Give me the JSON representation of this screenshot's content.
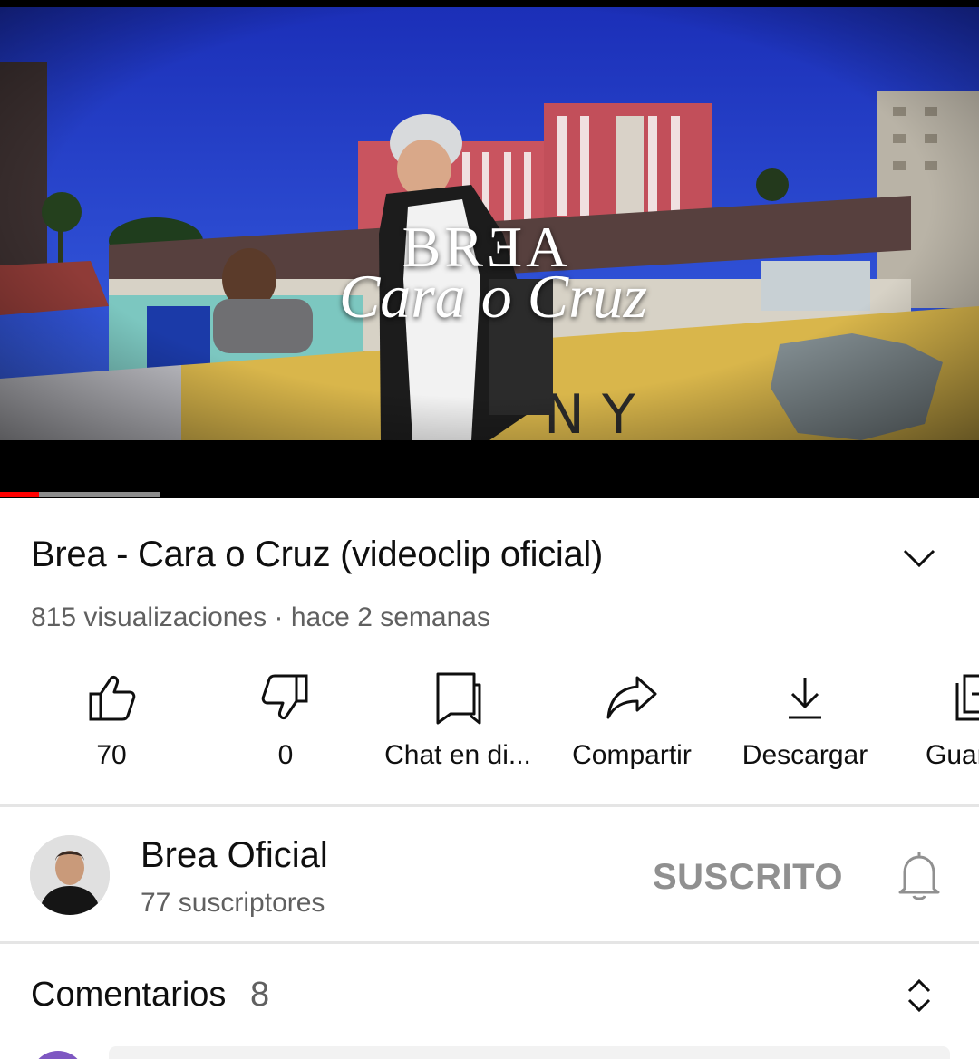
{
  "player": {
    "overlay_artist": "BRƎA",
    "overlay_song": "Cara o Cruz",
    "progress_watched": 0.04,
    "progress_buffered": 0.163,
    "progress_color": "#ff0000"
  },
  "video": {
    "title": "Brea - Cara o Cruz (videoclip oficial)",
    "meta": "815 visualizaciones · hace 2 semanas"
  },
  "actions": [
    {
      "icon": "thumbs-up-icon",
      "label": "70"
    },
    {
      "icon": "thumbs-down-icon",
      "label": "0"
    },
    {
      "icon": "chat-icon",
      "label": "Chat en di..."
    },
    {
      "icon": "share-icon",
      "label": "Compartir"
    },
    {
      "icon": "download-icon",
      "label": "Descargar"
    },
    {
      "icon": "save-icon",
      "label": "Guardar"
    }
  ],
  "channel": {
    "name": "Brea Oficial",
    "subscribers": "77 suscriptores",
    "subscribe_state": "SUSCRITO"
  },
  "comments": {
    "label": "Comentarios",
    "count": "8"
  }
}
